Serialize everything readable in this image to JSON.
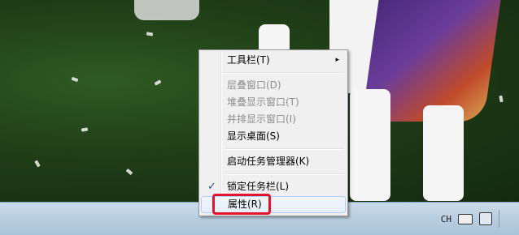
{
  "context_menu": {
    "items": [
      {
        "label": "工具栏(T)",
        "state": "enabled",
        "submenu": true
      },
      {
        "label": "层叠窗口(D)",
        "state": "disabled"
      },
      {
        "label": "堆叠显示窗口(T)",
        "state": "disabled"
      },
      {
        "label": "并排显示窗口(I)",
        "state": "disabled"
      },
      {
        "label": "显示桌面(S)",
        "state": "enabled"
      },
      {
        "label": "启动任务管理器(K)",
        "state": "enabled"
      },
      {
        "label": "锁定任务栏(L)",
        "state": "enabled",
        "checked": true
      },
      {
        "label": "属性(R)",
        "state": "hover"
      }
    ],
    "submenu_arrow": "▸",
    "check_mark": "✓"
  },
  "taskbar": {
    "language": "CH",
    "tray_icons": [
      "keyboard-icon",
      "network-icon"
    ]
  },
  "colors": {
    "highlight_box": "#e3142a",
    "taskbar": "#b9d0e2"
  }
}
